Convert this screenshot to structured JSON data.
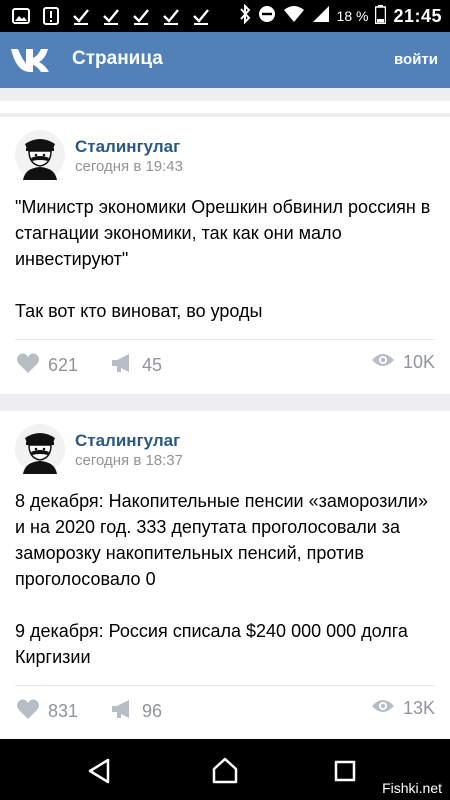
{
  "status_bar": {
    "battery_percent": "18 %",
    "time": "21:45"
  },
  "app_bar": {
    "title": "Страница",
    "login": "войти"
  },
  "posts": [
    {
      "author": "Сталингулаг",
      "time": "сегодня в 19:43",
      "text": "\"Министр экономики Орешкин обвинил россиян в стагнации экономики, так как они мало инвестируют\"\n\nТак вот кто виноват, во уроды",
      "likes": "621",
      "shares": "45",
      "views": "10K"
    },
    {
      "author": "Сталингулаг",
      "time": "сегодня в 18:37",
      "text": "8 декабря: Накопительные пенсии «заморозили» и на 2020 год. 333 депутата проголосовали за заморозку накопительных пенсий, против проголосовало 0\n\n9 декабря: Россия списала $240 000 000 долга Киргизии",
      "likes": "831",
      "shares": "96",
      "views": "13K"
    }
  ],
  "watermark": "Fishki.net",
  "colors": {
    "header": "#5181b8",
    "author_link": "#2a5885",
    "muted": "#939393",
    "feed_bg": "#edeef0"
  }
}
